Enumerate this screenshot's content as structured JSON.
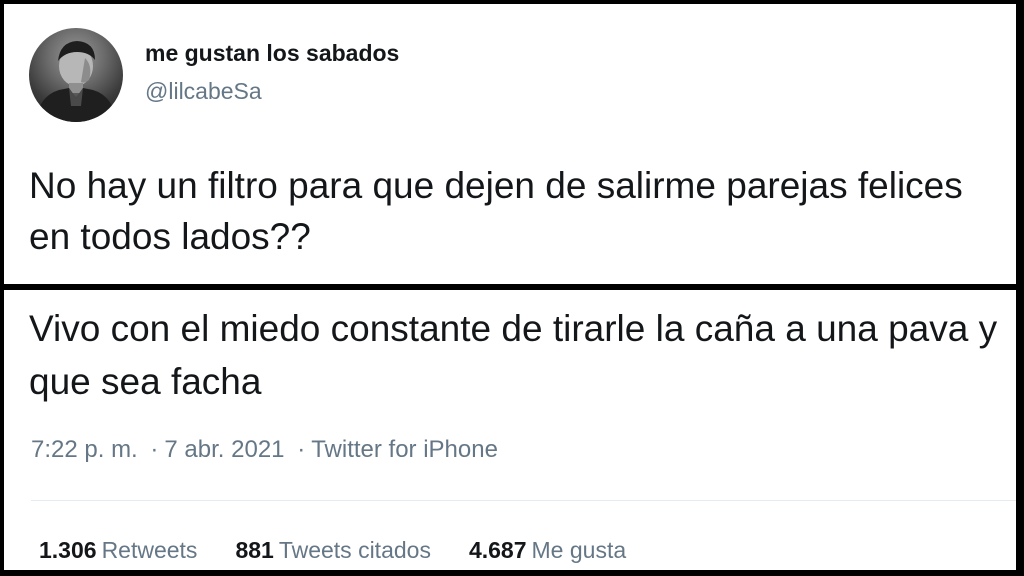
{
  "tweet_1": {
    "user": {
      "display_name": "me gustan los sabados",
      "handle": "@lilcabeSa",
      "avatar": "user-avatar-photo"
    },
    "text": "No hay un filtro para que dejen de salirme parejas felices en todos lados??"
  },
  "tweet_2": {
    "text": "Vivo con el miedo constante de tirarle la caña a una pava y que sea facha",
    "meta": {
      "time": "7:22 p. m.",
      "separator": "·",
      "date": "7 abr. 2021",
      "source": "Twitter for iPhone"
    },
    "stats": [
      {
        "value": "1.306",
        "label": "Retweets"
      },
      {
        "value": "881",
        "label": "Tweets citados"
      },
      {
        "value": "4.687",
        "label": "Me gusta"
      }
    ]
  },
  "colors": {
    "text_primary": "#14171a",
    "text_secondary": "#657786",
    "divider": "#e6ecf0",
    "frame": "#000000"
  }
}
